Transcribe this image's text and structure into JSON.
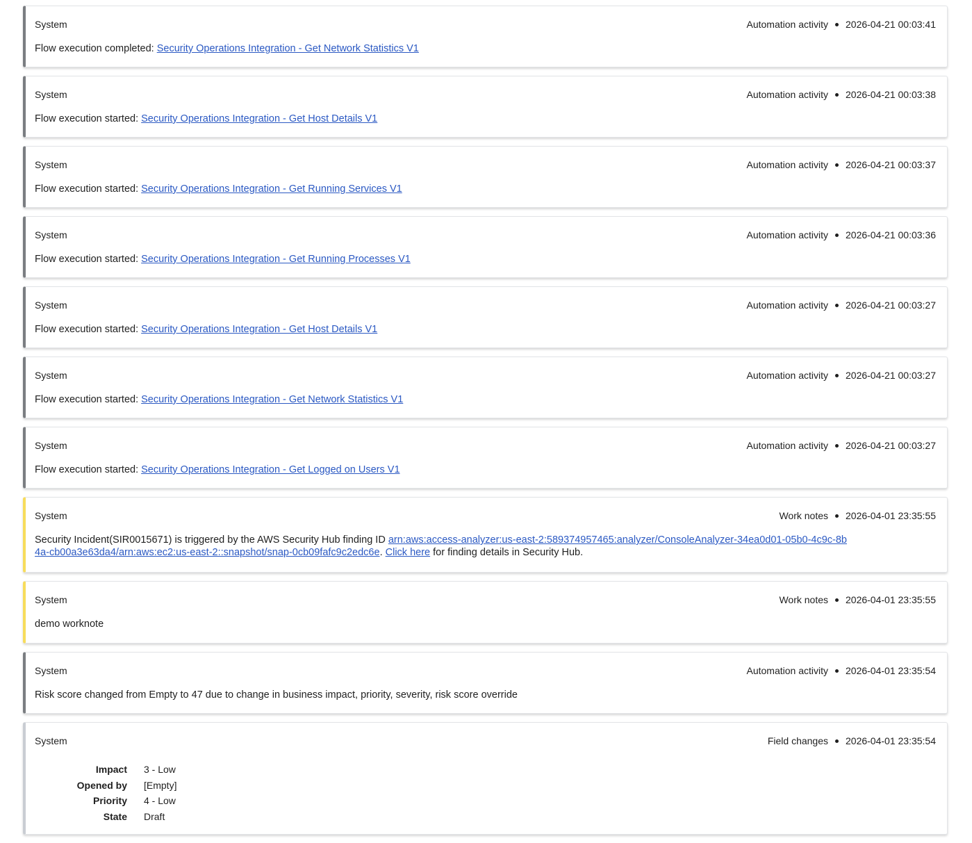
{
  "entries": [
    {
      "author": "System",
      "category": "Automation activity",
      "timestamp": "2026-04-21 00:03:41",
      "prefix": "Flow execution completed: ",
      "link": "Security Operations Integration - Get Network Statistics V1"
    },
    {
      "author": "System",
      "category": "Automation activity",
      "timestamp": "2026-04-21 00:03:38",
      "prefix": "Flow execution started: ",
      "link": "Security Operations Integration - Get Host Details V1"
    },
    {
      "author": "System",
      "category": "Automation activity",
      "timestamp": "2026-04-21 00:03:37",
      "prefix": "Flow execution started: ",
      "link": "Security Operations Integration - Get Running Services V1"
    },
    {
      "author": "System",
      "category": "Automation activity",
      "timestamp": "2026-04-21 00:03:36",
      "prefix": "Flow execution started: ",
      "link": "Security Operations Integration - Get Running Processes V1"
    },
    {
      "author": "System",
      "category": "Automation activity",
      "timestamp": "2026-04-21 00:03:27",
      "prefix": "Flow execution started: ",
      "link": "Security Operations Integration - Get Host Details V1"
    },
    {
      "author": "System",
      "category": "Automation activity",
      "timestamp": "2026-04-21 00:03:27",
      "prefix": "Flow execution started: ",
      "link": "Security Operations Integration - Get Network Statistics V1"
    },
    {
      "author": "System",
      "category": "Automation activity",
      "timestamp": "2026-04-21 00:03:27",
      "prefix": "Flow execution started: ",
      "link": "Security Operations Integration - Get Logged on Users V1"
    }
  ],
  "incident_note": {
    "author": "System",
    "category": "Work notes",
    "timestamp": "2026-04-01 23:35:55",
    "text_before": "Security Incident(SIR0015671) is triggered by the AWS Security Hub finding ID ",
    "finding_link": "arn:aws:access-analyzer:us-east-2:589374957465:analyzer/ConsoleAnalyzer-34ea0d01-05b0-4c9c-8b4a-cb00a3e63da4/arn:aws:ec2:us-east-2::snapshot/snap-0cb09fafc9c2edc6e",
    "text_mid": ". ",
    "click_link": "Click here",
    "text_after": " for finding details in Security Hub."
  },
  "demo_note": {
    "author": "System",
    "category": "Work notes",
    "timestamp": "2026-04-01 23:35:55",
    "text": "demo worknote"
  },
  "risk_entry": {
    "author": "System",
    "category": "Automation activity",
    "timestamp": "2026-04-01 23:35:54",
    "text": "Risk score changed from Empty to 47 due to change in business impact, priority, severity, risk score override"
  },
  "field_changes": {
    "author": "System",
    "category": "Field changes",
    "timestamp": "2026-04-01 23:35:54",
    "rows": [
      {
        "label": "Impact",
        "value": "3 - Low"
      },
      {
        "label": "Opened by",
        "value": "[Empty]"
      },
      {
        "label": "Priority",
        "value": "4 - Low"
      },
      {
        "label": "State",
        "value": "Draft"
      }
    ]
  },
  "colors": {
    "link": "#2b59c3",
    "automation_bar": "#7a7d81",
    "worknote_bar": "#f7dc5c",
    "fieldchange_bar": "#c9cdd3"
  }
}
